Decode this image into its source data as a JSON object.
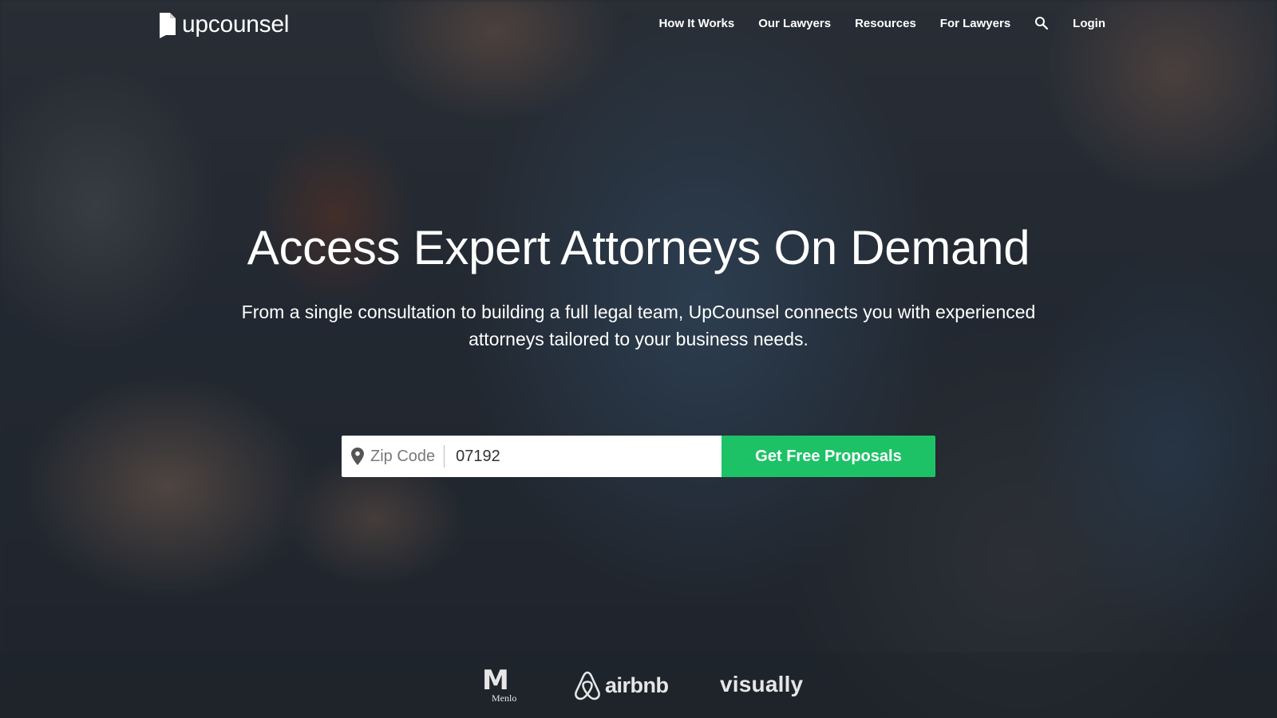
{
  "brand": {
    "name": "upcounsel",
    "accent_color": "#1dc266"
  },
  "nav": {
    "items": [
      {
        "label": "How It Works"
      },
      {
        "label": "Our Lawyers"
      },
      {
        "label": "Resources"
      },
      {
        "label": "For Lawyers"
      }
    ],
    "search_icon": "search-icon",
    "login_label": "Login"
  },
  "hero": {
    "title": "Access Expert Attorneys On Demand",
    "subtitle": "From a single consultation to building a full legal team, UpCounsel connects you with experienced attorneys tailored to your business needs."
  },
  "search": {
    "icon": "location-pin-icon",
    "label": "Zip Code",
    "value": "07192",
    "button_label": "Get Free Proposals"
  },
  "clients": {
    "menlo": {
      "mark": "M",
      "name": "Menlo"
    },
    "airbnb": {
      "name": "airbnb"
    },
    "visually": {
      "name": "visually"
    }
  }
}
